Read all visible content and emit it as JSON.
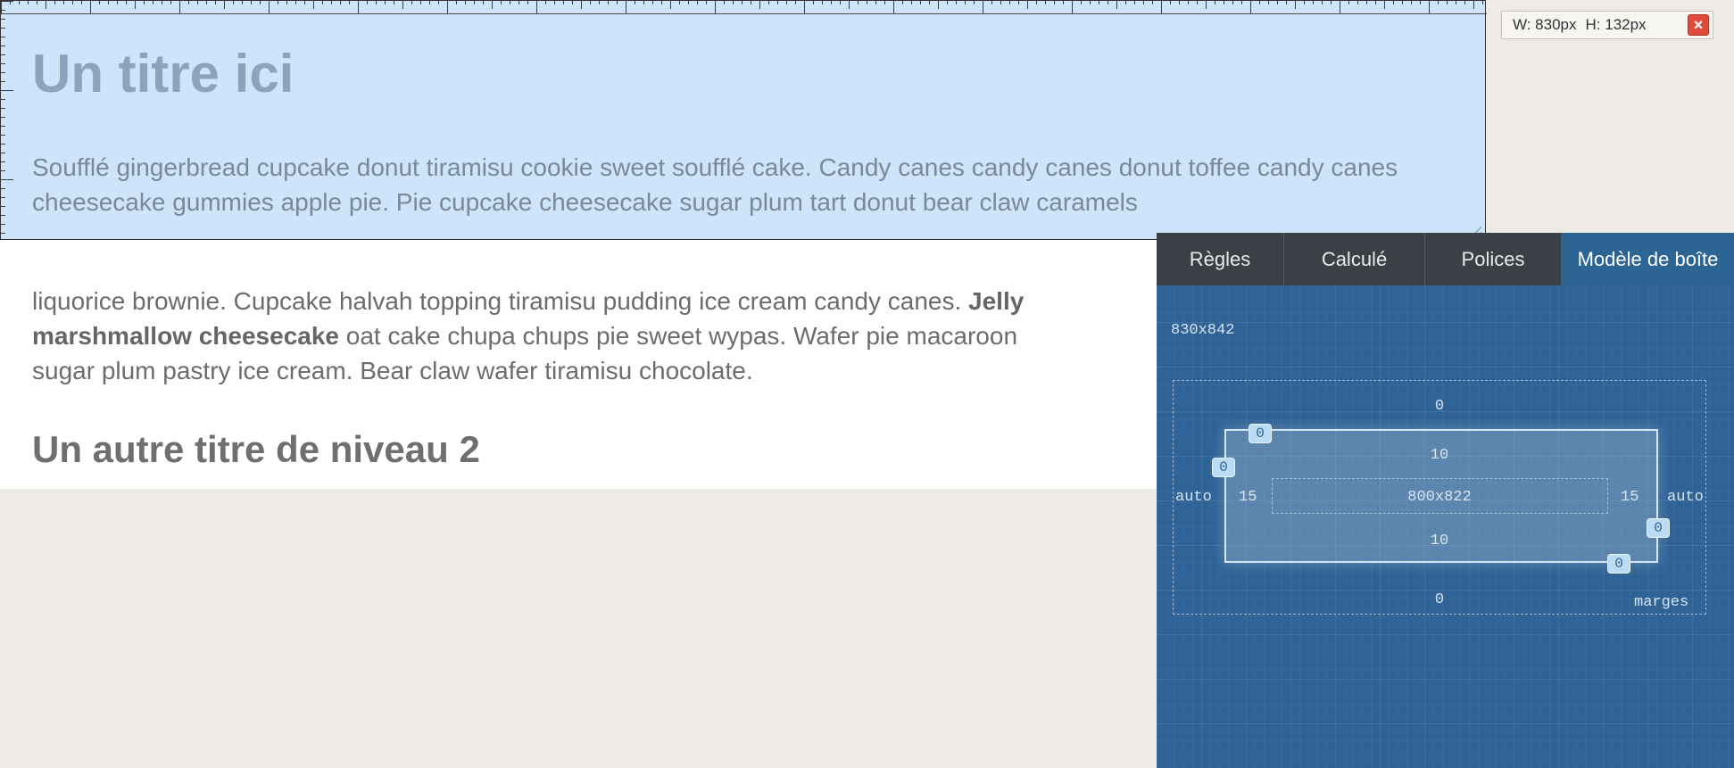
{
  "page": {
    "h1": "Un titre ici",
    "p1": "Soufflé gingerbread cupcake donut tiramisu cookie sweet soufflé cake. Candy canes candy canes donut toffee candy canes cheesecake gummies apple pie. Pie cupcake cheesecake sugar plum tart donut bear claw caramels",
    "p2_a": "liquorice brownie. Cupcake halvah topping tiramisu pudding ice cream candy canes. ",
    "p2_bold1": "Jelly",
    "p2_bold2": "marshmallow cheesecake",
    "p2_b": " oat cake chupa chups pie sweet wypas. Wafer pie macaroon",
    "p2_c": "sugar plum pastry ice cream. Bear claw wafer tiramisu chocolate.",
    "h2": "Un autre titre de niveau 2"
  },
  "dimension_badge": {
    "width_text": "W: 830px",
    "height_text": "H: 132px",
    "close_symbol": "×",
    "close_icon": "close-icon"
  },
  "inspector": {
    "tabs": [
      "Règles",
      "Calculé",
      "Polices",
      "Modèle de boîte"
    ],
    "active_tab": "Modèle de boîte",
    "element_size": "830x842",
    "margin": {
      "top": "0",
      "bottom": "0",
      "left": "auto",
      "right": "auto",
      "label": "marges"
    },
    "border": {
      "top": "0",
      "left": "0",
      "right": "0",
      "bottom": "0"
    },
    "padding": {
      "top": "10",
      "bottom": "10",
      "left": "15",
      "right": "15"
    },
    "content_size": "800x822"
  },
  "colors": {
    "highlight": "#cde4fb",
    "inspector_bg": "#2f6397",
    "tab_bar": "#3b4047",
    "close": "#e04a3b"
  }
}
